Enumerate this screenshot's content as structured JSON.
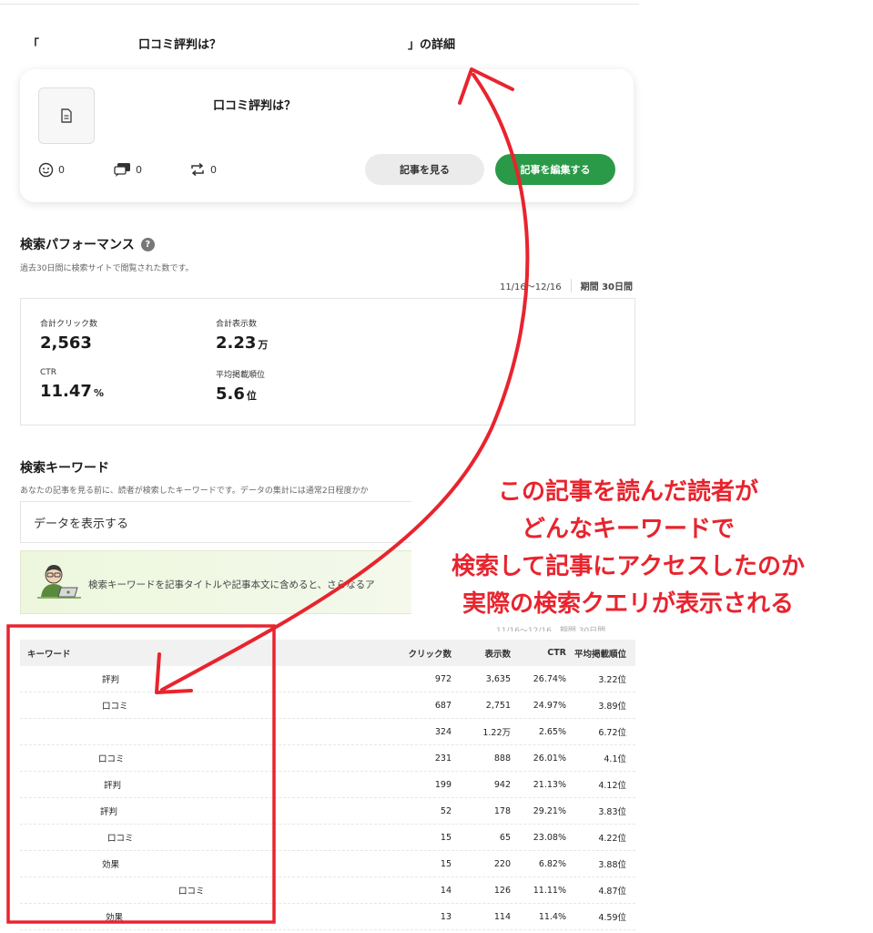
{
  "page_title": {
    "open_bracket": "「",
    "article_part": "口コミ評判は？",
    "close_part": "」の詳細"
  },
  "article_card": {
    "title": "口コミ評判は？",
    "stats": [
      {
        "icon": "smile-icon",
        "value": "0"
      },
      {
        "icon": "comment-icon",
        "value": "0"
      },
      {
        "icon": "repost-icon",
        "value": "0"
      }
    ],
    "view_button": "記事を見る",
    "edit_button": "記事を編集する"
  },
  "performance": {
    "title": "検索パフォーマンス",
    "help": "?",
    "subtitle": "過去30日間に検索サイトで閲覧された数です。",
    "period_range": "11/16〜12/16",
    "period_label": "期間 30日間",
    "metrics": [
      {
        "label": "合計クリック数",
        "value": "2,563",
        "unit": ""
      },
      {
        "label": "合計表示数",
        "value": "2.23",
        "unit": "万"
      },
      {
        "label": "CTR",
        "value": "11.47",
        "unit": "%"
      },
      {
        "label": "平均掲載順位",
        "value": "5.6",
        "unit": "位"
      }
    ]
  },
  "keywords": {
    "title": "検索キーワード",
    "subtitle": "あなたの記事を見る前に、読者が検索したキーワードです。データの集計には通常2日程度かか",
    "data_toggle": "データを表示する",
    "tip": "検索キーワードを記事タイトルや記事本文に含めると、さらなるア",
    "table_period": "11/16〜12/16　期間 30日間",
    "columns": {
      "keyword": "キーワード",
      "clicks": "クリック数",
      "impressions": "表示数",
      "ctr": "CTR",
      "rank": "平均掲載順位"
    },
    "rows": [
      {
        "keyword": "評判",
        "clicks": "972",
        "impressions": "3,635",
        "ctr": "26.74%",
        "rank": "3.22位"
      },
      {
        "keyword": "口コミ",
        "clicks": "687",
        "impressions": "2,751",
        "ctr": "24.97%",
        "rank": "3.89位"
      },
      {
        "keyword": "",
        "clicks": "324",
        "impressions": "1.22万",
        "ctr": "2.65%",
        "rank": "6.72位"
      },
      {
        "keyword": "口コミ",
        "clicks": "231",
        "impressions": "888",
        "ctr": "26.01%",
        "rank": "4.1位"
      },
      {
        "keyword": "評判",
        "clicks": "199",
        "impressions": "942",
        "ctr": "21.13%",
        "rank": "4.12位"
      },
      {
        "keyword": "評判",
        "clicks": "52",
        "impressions": "178",
        "ctr": "29.21%",
        "rank": "3.83位"
      },
      {
        "keyword": "口コミ",
        "clicks": "15",
        "impressions": "65",
        "ctr": "23.08%",
        "rank": "4.22位"
      },
      {
        "keyword": "効果",
        "clicks": "15",
        "impressions": "220",
        "ctr": "6.82%",
        "rank": "3.88位"
      },
      {
        "keyword": "口コミ",
        "clicks": "14",
        "impressions": "126",
        "ctr": "11.11%",
        "rank": "4.87位"
      },
      {
        "keyword": "効果",
        "clicks": "13",
        "impressions": "114",
        "ctr": "11.4%",
        "rank": "4.59位"
      }
    ]
  },
  "annotation": {
    "lines": [
      "この記事を読んだ読者が",
      "どんなキーワードで",
      "検索して記事にアクセスしたのか",
      "実際の検索クエリが表示される"
    ],
    "color": "#e8242e"
  },
  "colors": {
    "accent": "#2b9a48",
    "annotation": "#e8242e"
  }
}
